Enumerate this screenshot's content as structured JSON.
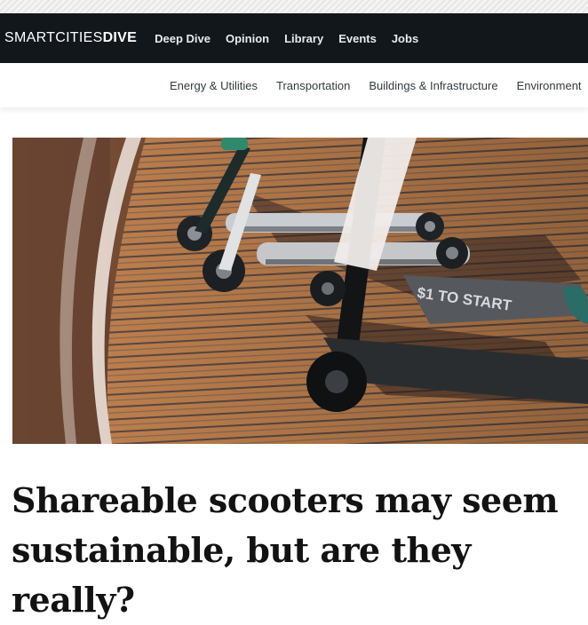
{
  "site": {
    "logo_light": "SMARTCITIES",
    "logo_bold": "DIVE"
  },
  "nav": {
    "items": [
      "Deep Dive",
      "Opinion",
      "Library",
      "Events",
      "Jobs"
    ]
  },
  "subnav": {
    "items": [
      "Energy & Utilities",
      "Transportation",
      "Buildings & Infrastructure",
      "Environment"
    ]
  },
  "hero": {
    "deck_text": "$1 TO START"
  },
  "article": {
    "title": "Shareable scooters may seem sustainable, but are they really?"
  },
  "colors": {
    "nav_bg": "#12171b",
    "sidewalk": "#b9784a"
  }
}
